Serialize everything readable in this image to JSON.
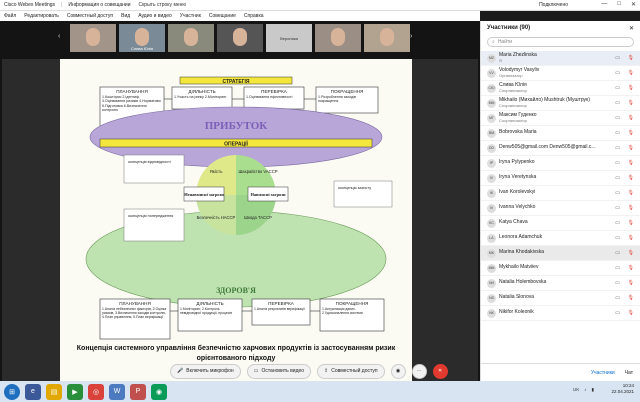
{
  "titlebar": {
    "app_title": "Cisco Webex Meetings",
    "info_label": "Информация о совещании",
    "hide_menu_label": "Скрыть строку меню",
    "connection_label": "Подключено",
    "window_buttons": [
      "—",
      "□",
      "✕"
    ]
  },
  "menu": [
    "Файл",
    "Редактировать",
    "Совместный доступ",
    "Вид",
    "Аудио и видео",
    "Участник",
    "Совещание",
    "Справка"
  ],
  "thumbnails": [
    {
      "label": ""
    },
    {
      "label": "Слива Юлія"
    },
    {
      "label": ""
    },
    {
      "label": ""
    },
    {
      "label": "Вероника"
    },
    {
      "label": ""
    },
    {
      "label": ""
    }
  ],
  "slide": {
    "top_band": "СТРАТЕГІЯ",
    "profit": "ПРИБУТОК",
    "operations": "ОПЕРАЦІЇ",
    "health": "ЗДОРОВ'Я",
    "plan_top": "ПЛАНУВАННЯ",
    "plan_top_items": "1.Кошторис 2.Ідентиф. 3.Оцінювання ризиків 4.Нормативи 5.Підготовка 6.Визначення контролю",
    "act_top": "ДІЯЛЬНІСТЬ",
    "act_top_items": "1.Участь на ринку 2.Моніторинг",
    "check_top": "ПЕРЕВІРКА",
    "check_top_items": "1.Оцінювання ефективності",
    "improve_top": "ПОКРАЩЕННЯ",
    "improve_top_items": "1.Розроблення заходів покращення",
    "left_note_top": "•концепція відповідності",
    "left_note_bottom": "•концепція попередження",
    "right_note": "•концепція захисту",
    "q_quality": "Якість",
    "q_security": "Шахрайство VACCP",
    "q_safety": "Безпечність НАССР",
    "q_defense": "Шкода TACCP",
    "threat_unintent": "Ненавмисні загрози",
    "threat_intent": "Навмисні загрози",
    "plan_bot": "ПЛАНУВАННЯ",
    "plan_bot_items": "1.Аналіз небезпечних факторів, 2.Оцінка ризиків, 3.Визначення заходів контролю, 4.План управління, 5.План верифікації",
    "act_bot": "ДІЯЛЬНІСТЬ",
    "act_bot_items": "1.Моніторинг, 2.Контроль невідповідної продукції, процесів",
    "check_bot": "ПЕРЕВІРКА",
    "check_bot_items": "1.Аналіз результатів верифікації",
    "improve_bot": "ПОКРАЩЕННЯ",
    "improve_bot_items": "1.Актуалізація даних, 2.Удосконалення системи",
    "caption": "Концепція системного управління безпечністю харчових продуктів із застосуванням ризик орієнтованого підходу"
  },
  "toolbar": {
    "mic": "Включить микрофон",
    "video": "Остановить видео",
    "share": "Совместный доступ",
    "participants": "Участники",
    "chat": "Чат"
  },
  "panel": {
    "title": "Участники (90)",
    "search_placeholder": "Найти",
    "participants": [
      {
        "initials": "MZ",
        "name": "Maria Zhezlinska",
        "role": "Я"
      },
      {
        "initials": "VV",
        "name": "Volodymyr Vasyliv",
        "role": "Организатор"
      },
      {
        "initials": "СЮ",
        "name": "Слива Юлія",
        "role": "Соорганизатор"
      },
      {
        "initials": "MM",
        "name": "Mikhailo (Михайло) Mushtruk (Муштрук)",
        "role": "Соорганизатор"
      },
      {
        "initials": "МГ",
        "name": "Максим Гуденко",
        "role": "Соорганизатор"
      },
      {
        "initials": "BM",
        "name": "Bobrovska Maria",
        "role": ""
      },
      {
        "initials": "DD",
        "name": "Denw505@gmail.com Denw505@gmail.c...",
        "role": ""
      },
      {
        "initials": "IP",
        "name": "Iryna Pylypenko",
        "role": ""
      },
      {
        "initials": "IV",
        "name": "Iryna Veretynska",
        "role": ""
      },
      {
        "initials": "IK",
        "name": "Ivan Korolevskyi",
        "role": ""
      },
      {
        "initials": "IV",
        "name": "Ivanna Velychko",
        "role": ""
      },
      {
        "initials": "KC",
        "name": "Katya Chava",
        "role": ""
      },
      {
        "initials": "LA",
        "name": "Leonora Adamchuk",
        "role": ""
      },
      {
        "initials": "MK",
        "name": "Marina Khodakivska",
        "role": ""
      },
      {
        "initials": "MM",
        "name": "Mykhailo Matviiev",
        "role": ""
      },
      {
        "initials": "NH",
        "name": "Natalia Holembovska",
        "role": ""
      },
      {
        "initials": "NS",
        "name": "Natalia Slonova",
        "role": ""
      },
      {
        "initials": "NK",
        "name": "Nikifor Koleonik",
        "role": ""
      }
    ]
  },
  "taskbar": {
    "lang": "UK",
    "time": "10:24",
    "date": "22.04.2021"
  },
  "colors": {
    "end_button": "#e23a2e",
    "panel_highlight": "#e9eef6",
    "profit_purple": "#b9a6d8",
    "health_green": "#bfe3b0",
    "yellow_band": "#f3e63c"
  }
}
